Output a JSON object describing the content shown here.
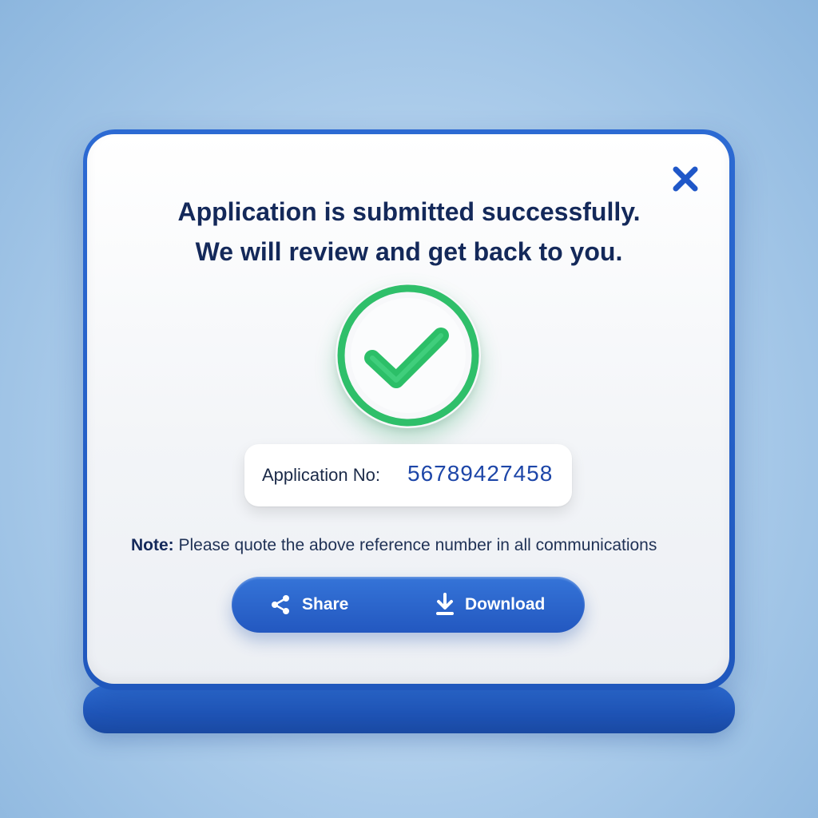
{
  "dialog": {
    "headline_line1": "Application is submitted successfully.",
    "headline_line2": "We will review and get back to you.",
    "status_icon": "check-circle-icon",
    "close_icon": "close-icon",
    "application": {
      "label": "Application No:",
      "number": "56789427458"
    },
    "note": {
      "title": "Note:",
      "text": " Please quote the above reference number in all communications"
    },
    "actions": {
      "share_label": "Share",
      "share_icon": "share-icon",
      "download_label": "Download",
      "download_icon": "download-icon"
    }
  },
  "colors": {
    "accent_blue": "#2358c0",
    "success_green": "#2fbf6a",
    "heading_navy": "#14295a",
    "number_blue": "#1d46a8"
  }
}
